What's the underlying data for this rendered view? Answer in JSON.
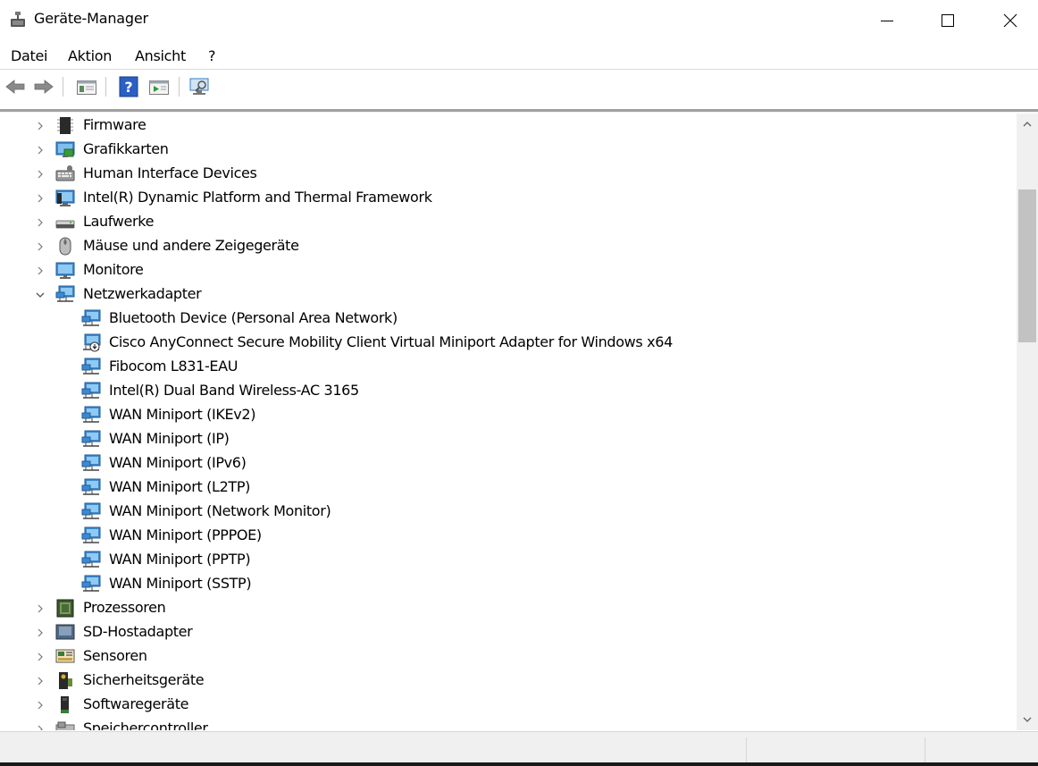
{
  "window": {
    "title": "Geräte-Manager",
    "controls": [
      "minimize",
      "maximize",
      "close"
    ]
  },
  "menu": [
    "Datei",
    "Aktion",
    "Ansicht",
    "?"
  ],
  "toolbar": {
    "buttons": [
      "back-arrow-icon",
      "forward-arrow-icon",
      "properties-icon",
      "help-icon",
      "update-driver-icon",
      "scan-hardware-icon"
    ]
  },
  "tree": {
    "categories_before": [
      {
        "label": "Firmware",
        "icon": "firmware-chip-icon"
      },
      {
        "label": "Grafikkarten",
        "icon": "display-adapter-icon"
      },
      {
        "label": "Human Interface Devices",
        "icon": "hid-keyboard-icon"
      },
      {
        "label": "Intel(R) Dynamic Platform and Thermal Framework",
        "icon": "thermal-framework-icon"
      },
      {
        "label": "Laufwerke",
        "icon": "disk-drive-icon"
      },
      {
        "label": "Mäuse und andere Zeigegeräte",
        "icon": "mouse-icon"
      },
      {
        "label": "Monitore",
        "icon": "monitor-icon"
      }
    ],
    "expanded": {
      "label": "Netzwerkadapter",
      "icon": "network-adapter-icon",
      "children": [
        "Bluetooth Device (Personal Area Network)",
        "Cisco AnyConnect Secure Mobility Client Virtual Miniport Adapter for Windows x64",
        "Fibocom L831-EAU",
        "Intel(R) Dual Band Wireless-AC 3165",
        "WAN Miniport (IKEv2)",
        "WAN Miniport (IP)",
        "WAN Miniport (IPv6)",
        "WAN Miniport (L2TP)",
        "WAN Miniport (Network Monitor)",
        "WAN Miniport (PPPOE)",
        "WAN Miniport (PPTP)",
        "WAN Miniport (SSTP)"
      ]
    },
    "categories_after": [
      {
        "label": "Prozessoren",
        "icon": "processor-icon"
      },
      {
        "label": "SD-Hostadapter",
        "icon": "sd-host-adapter-icon"
      },
      {
        "label": "Sensoren",
        "icon": "sensor-icon"
      },
      {
        "label": "Sicherheitsgeräte",
        "icon": "security-device-icon"
      },
      {
        "label": "Softwaregeräte",
        "icon": "software-device-icon"
      },
      {
        "label": "Speichercontroller",
        "icon": "storage-controller-icon"
      }
    ]
  },
  "colors": {
    "accent": "#1e73be",
    "scrollbar_thumb": "#c2c2c2",
    "statusbar": "#f0f0f0"
  }
}
